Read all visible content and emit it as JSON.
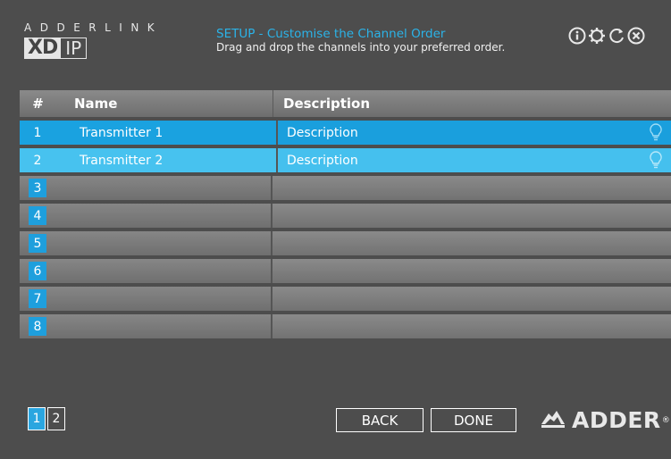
{
  "header": {
    "logo_top": "ADDERLINK",
    "logo_xd": "XD",
    "logo_ip": "IP",
    "title": "SETUP - Customise the Channel Order",
    "subtitle": "Drag and drop the channels into your preferred order.",
    "icons": [
      "info-icon",
      "settings-icon",
      "refresh-icon",
      "close-icon"
    ]
  },
  "table": {
    "columns": {
      "num": "#",
      "name": "Name",
      "description": "Description"
    },
    "rows": [
      {
        "num": "1",
        "name": "Transmitter 1",
        "description": "Description",
        "state": "selected"
      },
      {
        "num": "2",
        "name": "Transmitter 2",
        "description": "Description",
        "state": "highlighted"
      },
      {
        "num": "3",
        "name": "",
        "description": "",
        "state": "empty"
      },
      {
        "num": "4",
        "name": "",
        "description": "",
        "state": "empty"
      },
      {
        "num": "5",
        "name": "",
        "description": "",
        "state": "empty"
      },
      {
        "num": "6",
        "name": "",
        "description": "",
        "state": "empty"
      },
      {
        "num": "7",
        "name": "",
        "description": "",
        "state": "empty"
      },
      {
        "num": "8",
        "name": "",
        "description": "",
        "state": "empty"
      }
    ]
  },
  "footer": {
    "pages": [
      "1",
      "2"
    ],
    "back_label": "BACK",
    "done_label": "DONE",
    "brand": "ADDER",
    "brand_reg": "®"
  },
  "colors": {
    "accent": "#1aa2e0",
    "accent_light": "#47c2ef",
    "background": "#4d4d4d"
  }
}
